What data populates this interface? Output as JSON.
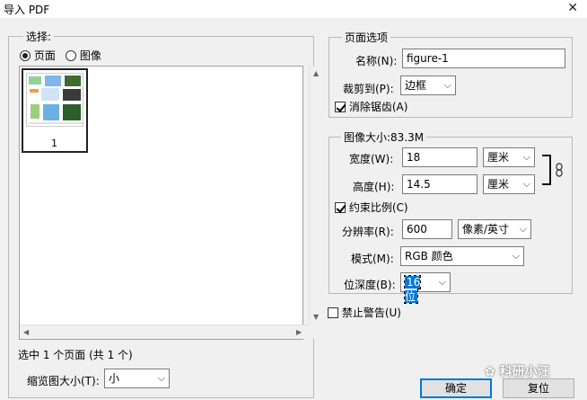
{
  "window": {
    "title": "导入 PDF",
    "close_icon": "close-icon"
  },
  "select_group": {
    "label": "选择:",
    "radio_page": "页面",
    "radio_image": "图像",
    "thumb_label": "1",
    "status": "选中 1 个页面 (共 1 个)",
    "thumb_size_label": "缩览图大小(T):",
    "thumb_size_value": "小"
  },
  "page_options": {
    "label": "页面选项",
    "name_label": "名称(N):",
    "name_value": "figure-1",
    "crop_label": "裁剪到(P):",
    "crop_value": "边框",
    "antialias_label": "消除锯齿(A)"
  },
  "image_size": {
    "label": "图像大小:83.3M",
    "width_label": "宽度(W):",
    "width_value": "18",
    "width_unit": "厘米",
    "height_label": "高度(H):",
    "height_value": "14.5",
    "height_unit": "厘米",
    "constrain_label": "约束比例(C)",
    "resolution_label": "分辨率(R):",
    "resolution_value": "600",
    "resolution_unit": "像素/英寸",
    "mode_label": "模式(M):",
    "mode_value": "RGB 颜色",
    "depth_label": "位深度(B):",
    "depth_value": "16 位"
  },
  "suppress_warnings_label": "禁止警告(U)",
  "buttons": {
    "ok": "确定",
    "reset": "复位"
  },
  "watermark": "科研小汪"
}
